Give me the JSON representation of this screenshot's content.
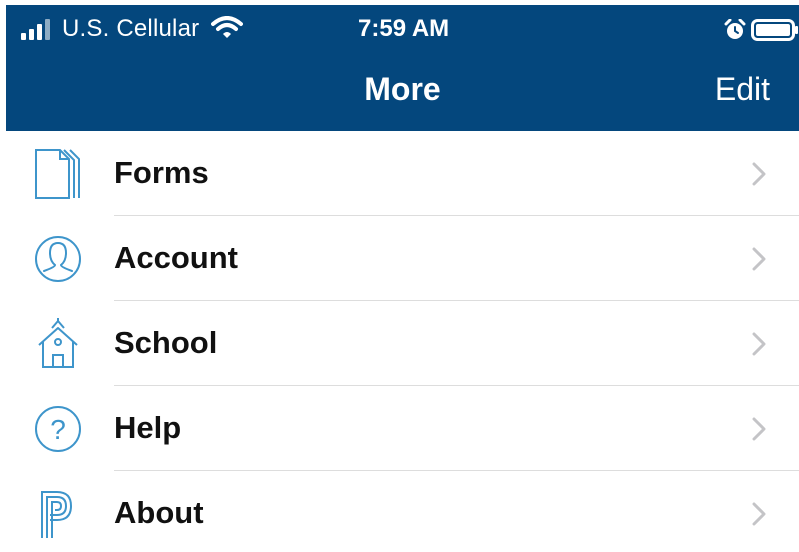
{
  "status_bar": {
    "carrier": "U.S. Cellular",
    "time": "7:59 AM"
  },
  "nav": {
    "title": "More",
    "edit_label": "Edit"
  },
  "menu": {
    "items": [
      {
        "label": "Forms",
        "icon": "forms-icon"
      },
      {
        "label": "Account",
        "icon": "account-icon"
      },
      {
        "label": "School",
        "icon": "school-icon"
      },
      {
        "label": "Help",
        "icon": "help-icon"
      },
      {
        "label": "About",
        "icon": "about-icon"
      }
    ]
  },
  "colors": {
    "header_bg": "#04477d",
    "icon_blue": "#3e95cb",
    "chevron": "#c4c4c7",
    "divider": "#dddddd"
  }
}
